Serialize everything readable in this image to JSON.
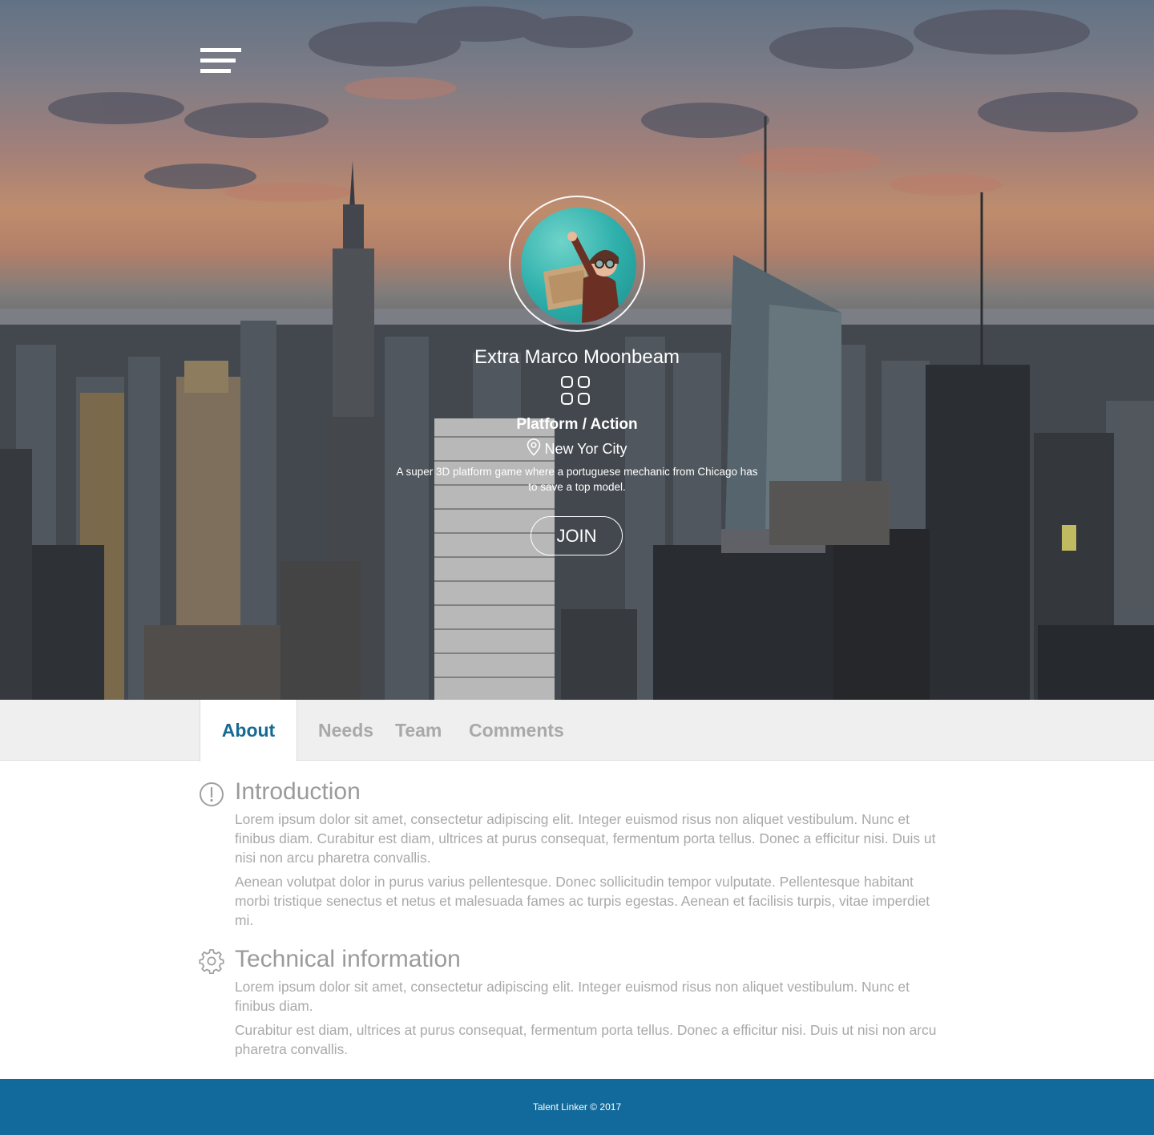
{
  "colors": {
    "accent": "#166a94",
    "footer": "#116a9b",
    "muted_text": "#a9a9a9",
    "tab_bar": "#efefef"
  },
  "header": {
    "menu_icon": "hamburger-menu-icon"
  },
  "project": {
    "name": "Extra Marco Moonbeam",
    "category_icon": "grid-icon",
    "category": "Platform / Action",
    "location_icon": "map-pin-icon",
    "location": "New Yor City",
    "description": "A super 3D platform game where a portuguese mechanic from Chicago has to save a top model.",
    "join_label": "JOIN"
  },
  "tabs": [
    {
      "label": "About",
      "active": true
    },
    {
      "label": "Needs",
      "active": false
    },
    {
      "label": "Team",
      "active": false
    },
    {
      "label": "Comments",
      "active": false
    }
  ],
  "sections": [
    {
      "icon": "info-circle-icon",
      "title": "Introduction",
      "paragraphs": [
        "Lorem ipsum dolor sit amet, consectetur adipiscing elit. Integer euismod risus non aliquet vestibulum. Nunc et finibus diam. Curabitur est diam, ultrices at purus consequat, fermentum porta tellus. Donec a efficitur nisi. Duis ut nisi non arcu pharetra convallis.",
        "Aenean volutpat dolor in purus varius pellentesque. Donec sollicitudin tempor vulputate. Pellentesque habitant morbi tristique senectus et netus et malesuada fames ac turpis egestas. Aenean et facilisis turpis, vitae imperdiet mi."
      ]
    },
    {
      "icon": "gear-icon",
      "title": "Technical information",
      "paragraphs": [
        "Lorem ipsum dolor sit amet, consectetur adipiscing elit. Integer euismod risus non aliquet vestibulum. Nunc et finibus diam.",
        "Curabitur est diam, ultrices at purus consequat, fermentum porta tellus. Donec a efficitur nisi. Duis ut nisi non arcu pharetra convallis."
      ]
    }
  ],
  "footer": {
    "text": "Talent Linker © 2017"
  }
}
